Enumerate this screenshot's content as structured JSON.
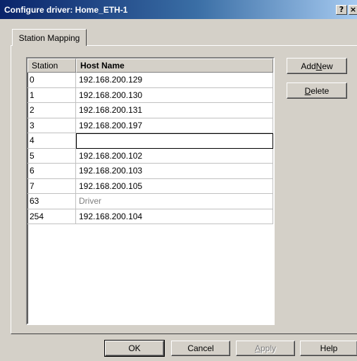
{
  "window": {
    "title": "Configure driver: Home_ETH-1",
    "help_label": "?",
    "close_label": "×"
  },
  "tabs": [
    {
      "label": "Station Mapping",
      "active": true
    }
  ],
  "grid": {
    "columns": [
      "Station",
      "Host Name"
    ],
    "rows": [
      {
        "station": "0",
        "host": "192.168.200.129"
      },
      {
        "station": "1",
        "host": "192.168.200.130"
      },
      {
        "station": "2",
        "host": "192.168.200.131"
      },
      {
        "station": "3",
        "host": "192.168.200.197"
      },
      {
        "station": "4",
        "host": "",
        "editing": true
      },
      {
        "station": "5",
        "host": "192.168.200.102"
      },
      {
        "station": "6",
        "host": "192.168.200.103"
      },
      {
        "station": "7",
        "host": "192.168.200.105"
      },
      {
        "station": "63",
        "host": "Driver",
        "muted": true
      },
      {
        "station": "254",
        "host": "192.168.200.104"
      }
    ]
  },
  "side_buttons": {
    "add_new": {
      "before": "Add ",
      "mnemonic": "N",
      "after": "ew"
    },
    "delete": {
      "before": "",
      "mnemonic": "D",
      "after": "elete"
    }
  },
  "footer_buttons": {
    "ok": "OK",
    "cancel": "Cancel",
    "apply": {
      "before": "",
      "mnemonic": "A",
      "after": "pply",
      "disabled": true
    },
    "help": "Help"
  }
}
